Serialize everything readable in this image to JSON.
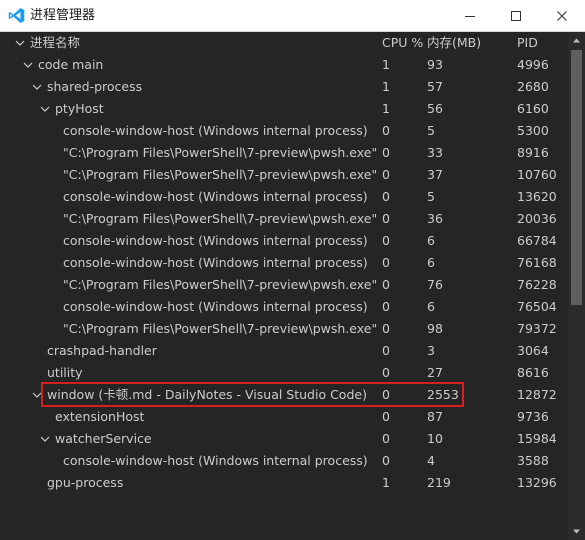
{
  "window": {
    "title": "进程管理器",
    "app_icon": "vscode-logo-icon",
    "accent": "#1f9cf0",
    "controls": [
      "minimize-icon",
      "maximize-icon",
      "close-icon"
    ]
  },
  "table": {
    "headers": {
      "name": "进程名称",
      "cpu": "CPU %",
      "mem": "内存(MB)",
      "pid": "PID"
    },
    "rows": [
      {
        "name": "code main",
        "cpu": "1",
        "mem": "93",
        "pid": "4996"
      },
      {
        "name": "shared-process",
        "cpu": "1",
        "mem": "57",
        "pid": "2680"
      },
      {
        "name": "ptyHost",
        "cpu": "1",
        "mem": "56",
        "pid": "6160"
      },
      {
        "name": "console-window-host (Windows internal process)",
        "cpu": "0",
        "mem": "5",
        "pid": "5300"
      },
      {
        "name": "\"C:\\Program Files\\PowerShell\\7-preview\\pwsh.exe\"",
        "cpu": "0",
        "mem": "33",
        "pid": "8916"
      },
      {
        "name": "\"C:\\Program Files\\PowerShell\\7-preview\\pwsh.exe\"",
        "cpu": "0",
        "mem": "37",
        "pid": "10760"
      },
      {
        "name": "console-window-host (Windows internal process)",
        "cpu": "0",
        "mem": "5",
        "pid": "13620"
      },
      {
        "name": "\"C:\\Program Files\\PowerShell\\7-preview\\pwsh.exe\"",
        "cpu": "0",
        "mem": "36",
        "pid": "20036"
      },
      {
        "name": "console-window-host (Windows internal process)",
        "cpu": "0",
        "mem": "6",
        "pid": "66784"
      },
      {
        "name": "console-window-host (Windows internal process)",
        "cpu": "0",
        "mem": "6",
        "pid": "76168"
      },
      {
        "name": "\"C:\\Program Files\\PowerShell\\7-preview\\pwsh.exe\"",
        "cpu": "0",
        "mem": "76",
        "pid": "76228"
      },
      {
        "name": "console-window-host (Windows internal process)",
        "cpu": "0",
        "mem": "6",
        "pid": "76504"
      },
      {
        "name": "\"C:\\Program Files\\PowerShell\\7-preview\\pwsh.exe\"",
        "cpu": "0",
        "mem": "98",
        "pid": "79372"
      },
      {
        "name": "crashpad-handler",
        "cpu": "0",
        "mem": "3",
        "pid": "3064"
      },
      {
        "name": "utility",
        "cpu": "0",
        "mem": "27",
        "pid": "8616"
      },
      {
        "name": "window (卡顿.md - DailyNotes - Visual Studio Code)",
        "cpu": "0",
        "mem": "2553",
        "pid": "12872"
      },
      {
        "name": "extensionHost",
        "cpu": "0",
        "mem": "87",
        "pid": "9736"
      },
      {
        "name": "watcherService",
        "cpu": "0",
        "mem": "10",
        "pid": "15984"
      },
      {
        "name": "console-window-host (Windows internal process)",
        "cpu": "0",
        "mem": "4",
        "pid": "3588"
      },
      {
        "name": "gpu-process",
        "cpu": "1",
        "mem": "219",
        "pid": "13296"
      }
    ]
  },
  "colors": {
    "background": "#252526",
    "text": "#cccccc",
    "highlight_border": "#d81e1e",
    "scroll_thumb": "#5f5f5f"
  }
}
